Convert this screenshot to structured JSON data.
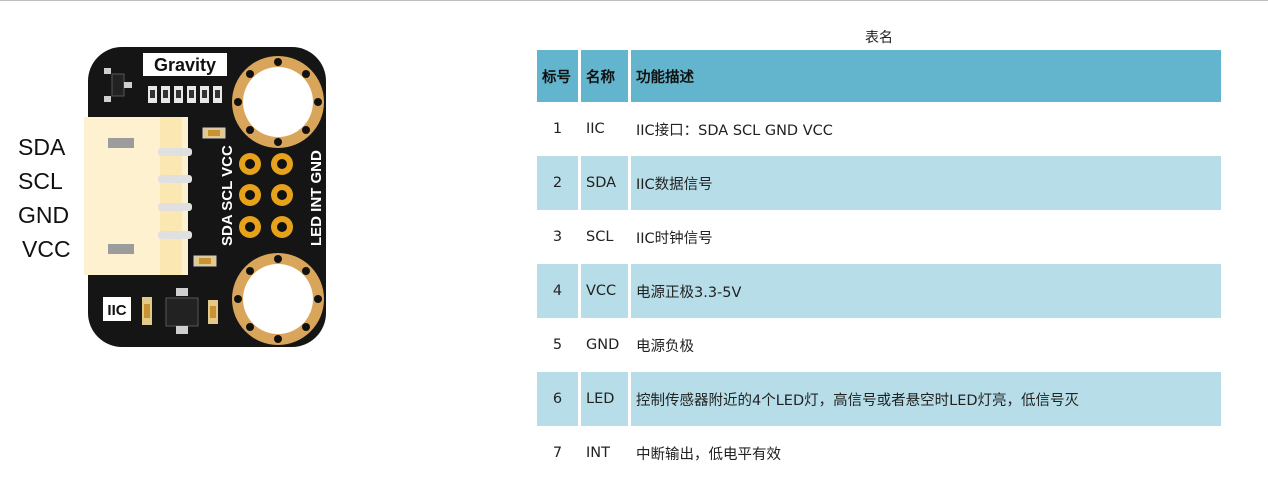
{
  "board": {
    "logo_text": "Gravity",
    "silk_iic": "IIC",
    "silk_left_col": "SDA SCL VCC",
    "silk_right_col": "LED INT GND",
    "pin_labels": [
      "SDA",
      "SCL",
      "GND",
      "VCC"
    ],
    "colors": {
      "pcb": "#151515",
      "connector": "#fdf1cf",
      "pad_ring": "#d9a55a",
      "pin_gold": "#e6a21a"
    }
  },
  "table": {
    "caption": "表名",
    "headers": [
      "标号",
      "名称",
      "功能描述"
    ],
    "rows": [
      {
        "num": "1",
        "name": "IIC",
        "desc": "IIC接口：SDA SCL GND VCC"
      },
      {
        "num": "2",
        "name": "SDA",
        "desc": "IIC数据信号"
      },
      {
        "num": "3",
        "name": "SCL",
        "desc": "IIC时钟信号"
      },
      {
        "num": "4",
        "name": "VCC",
        "desc": "电源正极3.3-5V"
      },
      {
        "num": "5",
        "name": "GND",
        "desc": "电源负极"
      },
      {
        "num": "6",
        "name": "LED",
        "desc": "控制传感器附近的4个LED灯，高信号或者悬空时LED灯亮，低信号灭"
      },
      {
        "num": "7",
        "name": "INT",
        "desc": "中断输出，低电平有效"
      }
    ],
    "colors": {
      "header": "#63b4cd",
      "shade": "#b7dee8"
    }
  }
}
